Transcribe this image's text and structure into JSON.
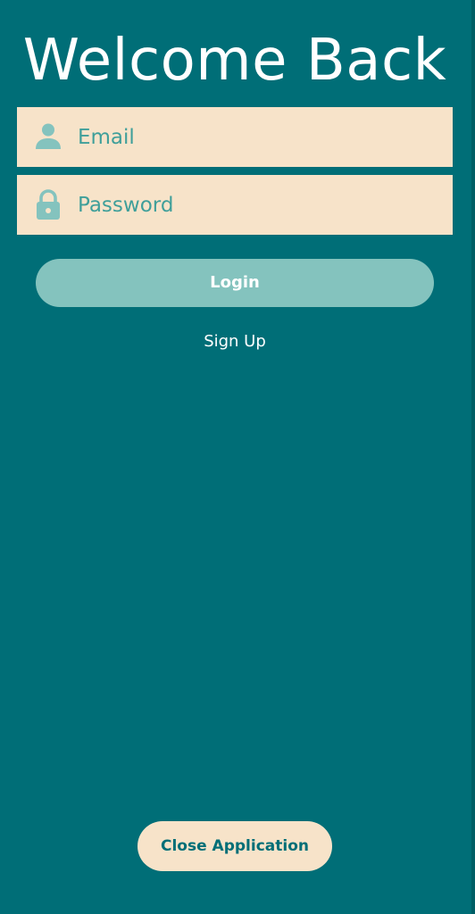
{
  "screen": {
    "title": "Welcome Back"
  },
  "form": {
    "email": {
      "value": "",
      "placeholder": "Email",
      "icon": "person-icon"
    },
    "password": {
      "value": "",
      "placeholder": "Password",
      "icon": "lock-icon"
    }
  },
  "actions": {
    "login_label": "Login",
    "signup_label": "Sign Up",
    "close_label": "Close Application"
  },
  "colors": {
    "background": "#006E77",
    "field_background": "#F7E3C9",
    "field_text": "#3F9F9A",
    "icon": "#84C3BE",
    "login_button": "#84C3BE",
    "close_button_text": "#006E77",
    "text": "#FFFFFF"
  }
}
